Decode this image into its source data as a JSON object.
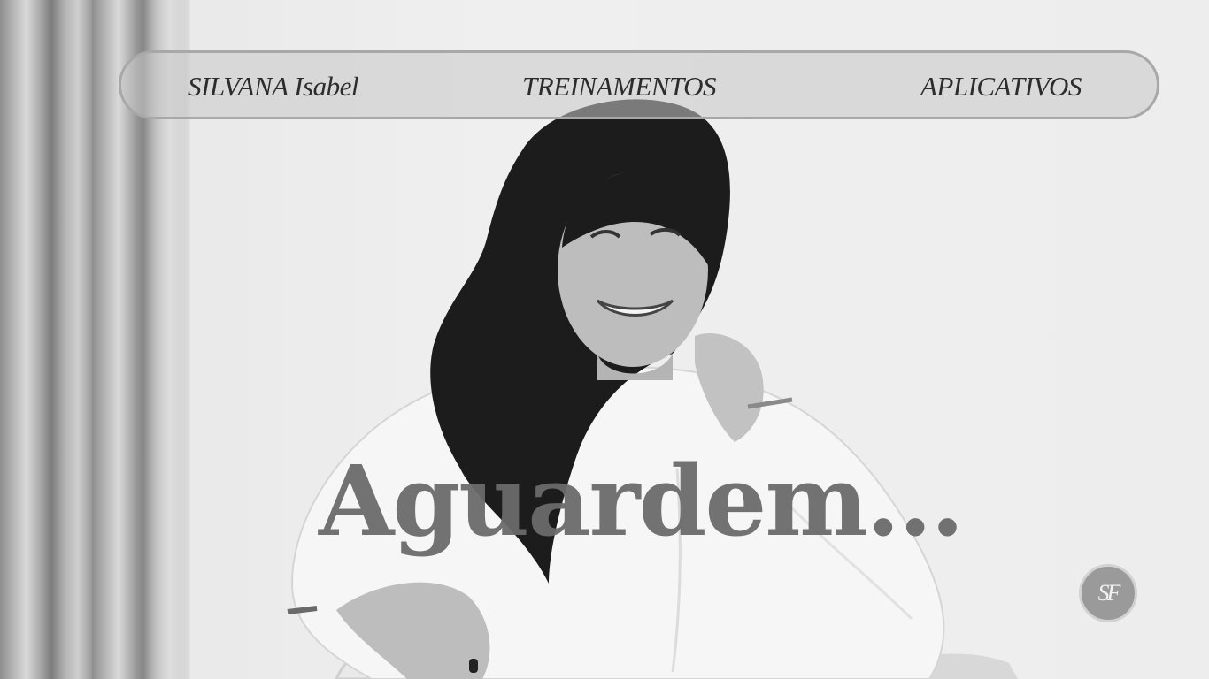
{
  "nav": {
    "brand": "SILVANA Isabel",
    "training": "TREINAMENTOS",
    "apps": "APLICATIVOS"
  },
  "main": {
    "headline": "Aguardem..."
  },
  "badge": {
    "initials": "SF"
  },
  "colors": {
    "nav_text": "#2c2c2c",
    "headline": "#6b6b6b",
    "nav_border": "#a8a8a8",
    "badge_bg": "#9a9a9a"
  }
}
